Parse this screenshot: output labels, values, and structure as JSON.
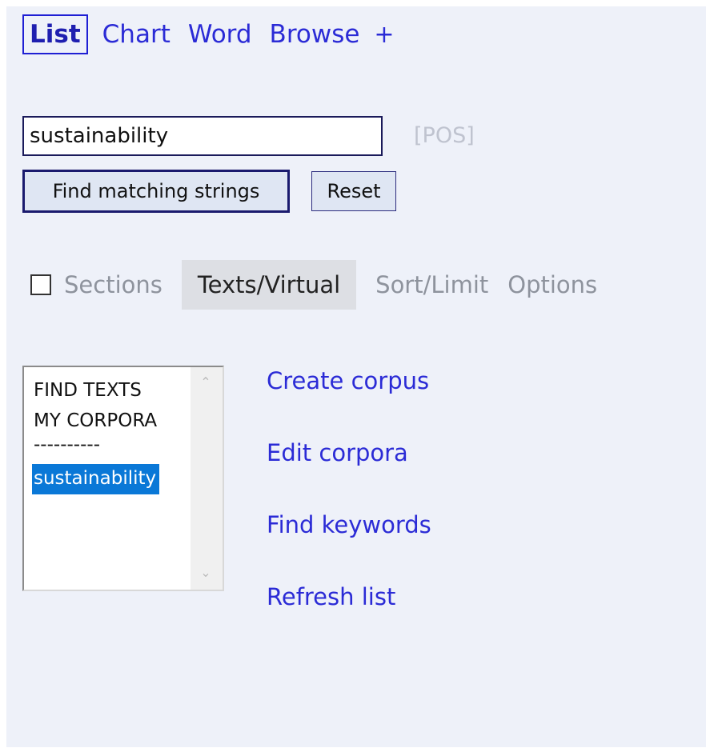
{
  "nav": {
    "tabs": [
      {
        "label": "List",
        "active": true
      },
      {
        "label": "Chart",
        "active": false
      },
      {
        "label": "Word",
        "active": false
      },
      {
        "label": "Browse",
        "active": false
      }
    ],
    "add_label": "+"
  },
  "search": {
    "value": "sustainability",
    "pos_label": "[POS]"
  },
  "buttons": {
    "find_label": "Find matching strings",
    "reset_label": "Reset"
  },
  "subtabs": {
    "sections_checked": false,
    "sections_label": "Sections",
    "texts_label": "Texts/Virtual",
    "sort_label": "Sort/Limit",
    "options_label": "Options"
  },
  "corpus_list": {
    "items": [
      "FIND TEXTS",
      "MY CORPORA",
      "----------",
      "sustainability"
    ],
    "selected": "sustainability"
  },
  "actions": {
    "create": "Create corpus",
    "edit": "Edit corpora",
    "keywords": "Find keywords",
    "refresh": "Refresh list"
  },
  "colors": {
    "panel_bg": "#eef1f9",
    "link": "#2b2bd6",
    "selection": "#0a78d7"
  },
  "icons": {
    "scroll_up": "chevron-up-icon",
    "scroll_down": "chevron-down-icon"
  }
}
